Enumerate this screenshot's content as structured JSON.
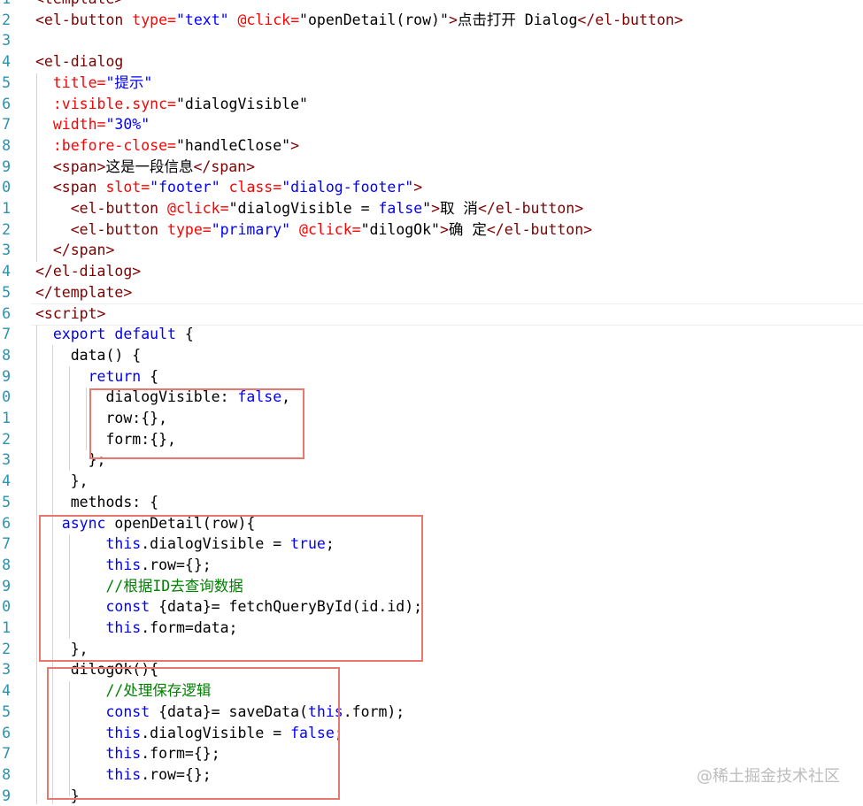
{
  "line_numbers": [
    "1",
    "2",
    "3",
    "4",
    "5",
    "6",
    "7",
    "8",
    "9",
    "0",
    "1",
    "2",
    "3",
    "4",
    "5",
    "6",
    "7",
    "8",
    "9",
    "0",
    "1",
    "2",
    "3",
    "4",
    "5",
    "6",
    "7",
    "8",
    "9",
    "0",
    "1",
    "2",
    "3",
    "4",
    "5",
    "6",
    "7",
    "8",
    "9"
  ],
  "lines": [
    [
      {
        "t": "<template>",
        "c": "c-tag"
      }
    ],
    [
      {
        "t": "<el-button",
        "c": "c-tag"
      },
      {
        "t": " type=",
        "c": "c-at"
      },
      {
        "t": "\"text\"",
        "c": "c-s"
      },
      {
        "t": " @click=",
        "c": "c-at"
      },
      {
        "t": "\"openDetail(row)\"",
        "c": "c-d"
      },
      {
        "t": ">",
        "c": "c-tag"
      },
      {
        "t": "点击打开 Dialog",
        "c": "c-d"
      },
      {
        "t": "</el-button>",
        "c": "c-tag"
      }
    ],
    [],
    [
      {
        "t": "<el-dialog",
        "c": "c-tag"
      }
    ],
    [
      {
        "t": "  title=",
        "c": "c-at"
      },
      {
        "t": "\"提示\"",
        "c": "c-s"
      }
    ],
    [
      {
        "t": "  :visible.sync=",
        "c": "c-at"
      },
      {
        "t": "\"dialogVisible\"",
        "c": "c-d"
      }
    ],
    [
      {
        "t": "  width=",
        "c": "c-at"
      },
      {
        "t": "\"30%\"",
        "c": "c-s"
      }
    ],
    [
      {
        "t": "  :before-close=",
        "c": "c-at"
      },
      {
        "t": "\"handleClose\"",
        "c": "c-d"
      },
      {
        "t": ">",
        "c": "c-tag"
      }
    ],
    [
      {
        "t": "  <span>",
        "c": "c-tag"
      },
      {
        "t": "这是一段信息",
        "c": "c-d"
      },
      {
        "t": "</span>",
        "c": "c-tag"
      }
    ],
    [
      {
        "t": "  <span",
        "c": "c-tag"
      },
      {
        "t": " slot=",
        "c": "c-at"
      },
      {
        "t": "\"footer\"",
        "c": "c-s"
      },
      {
        "t": " class=",
        "c": "c-at"
      },
      {
        "t": "\"dialog-footer\"",
        "c": "c-s"
      },
      {
        "t": ">",
        "c": "c-tag"
      }
    ],
    [
      {
        "t": "    <el-button",
        "c": "c-tag"
      },
      {
        "t": " @click=",
        "c": "c-at"
      },
      {
        "t": "\"dialogVisible = ",
        "c": "c-d"
      },
      {
        "t": "false",
        "c": "c-k"
      },
      {
        "t": "\"",
        "c": "c-d"
      },
      {
        "t": ">",
        "c": "c-tag"
      },
      {
        "t": "取 消",
        "c": "c-d"
      },
      {
        "t": "</el-button>",
        "c": "c-tag"
      }
    ],
    [
      {
        "t": "    <el-button",
        "c": "c-tag"
      },
      {
        "t": " type=",
        "c": "c-at"
      },
      {
        "t": "\"primary\"",
        "c": "c-s"
      },
      {
        "t": " @click=",
        "c": "c-at"
      },
      {
        "t": "\"dilogOk\"",
        "c": "c-d"
      },
      {
        "t": ">",
        "c": "c-tag"
      },
      {
        "t": "确 定",
        "c": "c-d"
      },
      {
        "t": "</el-button>",
        "c": "c-tag"
      }
    ],
    [
      {
        "t": "  </span>",
        "c": "c-tag"
      }
    ],
    [
      {
        "t": "</el-dialog>",
        "c": "c-tag"
      }
    ],
    [
      {
        "t": "</template>",
        "c": "c-tag"
      }
    ],
    [
      {
        "t": "<script>",
        "c": "c-tag"
      }
    ],
    [
      {
        "t": "  export default",
        "c": "c-k"
      },
      {
        "t": " {",
        "c": "c-d"
      }
    ],
    [
      {
        "t": "    data() {",
        "c": "c-d"
      }
    ],
    [
      {
        "t": "      return",
        "c": "c-k"
      },
      {
        "t": " {",
        "c": "c-d"
      }
    ],
    [
      {
        "t": "        dialogVisible: ",
        "c": "c-d"
      },
      {
        "t": "false",
        "c": "c-k"
      },
      {
        "t": ",",
        "c": "c-d"
      }
    ],
    [
      {
        "t": "        row:{},",
        "c": "c-d"
      }
    ],
    [
      {
        "t": "        form:{},",
        "c": "c-d"
      }
    ],
    [
      {
        "t": "      };",
        "c": "c-d"
      }
    ],
    [
      {
        "t": "    },",
        "c": "c-d"
      }
    ],
    [
      {
        "t": "    methods: {",
        "c": "c-d"
      }
    ],
    [
      {
        "t": "   async",
        "c": "c-k"
      },
      {
        "t": " openDetail(row){",
        "c": "c-d"
      }
    ],
    [
      {
        "t": "        this",
        "c": "c-k"
      },
      {
        "t": ".dialogVisible = ",
        "c": "c-d"
      },
      {
        "t": "true",
        "c": "c-k"
      },
      {
        "t": ";",
        "c": "c-d"
      }
    ],
    [
      {
        "t": "        this",
        "c": "c-k"
      },
      {
        "t": ".row={};",
        "c": "c-d"
      }
    ],
    [
      {
        "t": "        //根据ID去查询数据",
        "c": "c-cm"
      }
    ],
    [
      {
        "t": "        const",
        "c": "c-k"
      },
      {
        "t": " {data}= fetchQueryById(id.id);",
        "c": "c-d"
      }
    ],
    [
      {
        "t": "        this",
        "c": "c-k"
      },
      {
        "t": ".form=data;",
        "c": "c-d"
      }
    ],
    [
      {
        "t": "    },",
        "c": "c-d"
      }
    ],
    [
      {
        "t": "    dilogOk(){",
        "c": "c-d"
      }
    ],
    [
      {
        "t": "        //处理保存逻辑",
        "c": "c-cm"
      }
    ],
    [
      {
        "t": "        const",
        "c": "c-k"
      },
      {
        "t": " {data}= saveData(",
        "c": "c-d"
      },
      {
        "t": "this",
        "c": "c-k"
      },
      {
        "t": ".form);",
        "c": "c-d"
      }
    ],
    [
      {
        "t": "        this",
        "c": "c-k"
      },
      {
        "t": ".dialogVisible = ",
        "c": "c-d"
      },
      {
        "t": "false",
        "c": "c-k"
      },
      {
        "t": ";",
        "c": "c-d"
      }
    ],
    [
      {
        "t": "        this",
        "c": "c-k"
      },
      {
        "t": ".form={};",
        "c": "c-d"
      }
    ],
    [
      {
        "t": "        this",
        "c": "c-k"
      },
      {
        "t": ".row={};",
        "c": "c-d"
      }
    ],
    [
      {
        "t": "    }",
        "c": "c-d"
      }
    ]
  ],
  "watermark": "@稀土掘金技术社区",
  "colors": {
    "line_number": "#2b91af",
    "tag": "#800000",
    "attribute": "#ff0000",
    "string": "#0000ff",
    "keyword": "#0000ff",
    "comment": "#008000",
    "highlight_box": "#e8786d"
  }
}
